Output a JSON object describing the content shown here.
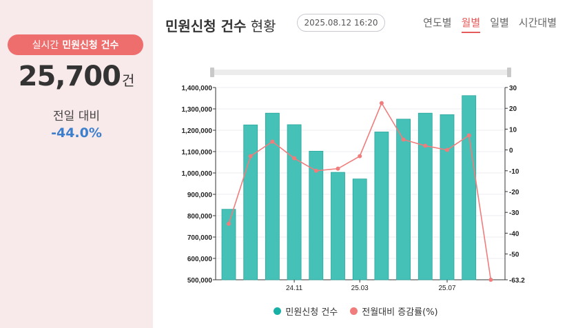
{
  "sidebar": {
    "realtime_prefix": "실시간",
    "realtime_bold": "민원신청 건수",
    "count": "25,700",
    "count_unit": "건",
    "compare_label": "전일 대비",
    "compare_value": "-44.0%"
  },
  "header": {
    "title_bold": "민원신청 건수",
    "title_rest": "현황",
    "datetime": "2025.08.12 16:20"
  },
  "tabs": [
    {
      "label": "연도별",
      "active": false
    },
    {
      "label": "월별",
      "active": true
    },
    {
      "label": "일별",
      "active": false
    },
    {
      "label": "시간대별",
      "active": false
    }
  ],
  "colors": {
    "bar": "#45c1b7",
    "line": "#f07c7c",
    "accent": "#ee6e6e",
    "compare": "#3d7fcc"
  },
  "chart_data": {
    "type": "bar",
    "categories": [
      "",
      "",
      "",
      "24.11",
      "",
      "",
      "25.03",
      "",
      "",
      "",
      "25.07",
      ""
    ],
    "series": [
      {
        "name": "민원신청 건수",
        "type": "bar",
        "axis": "left",
        "color": "#45c1b7",
        "values": [
          830000,
          1225000,
          1280000,
          1226000,
          1102000,
          1003000,
          972000,
          1192000,
          1252000,
          1280000,
          1273000,
          1362000,
          null
        ]
      },
      {
        "name": "전월대비 증감률(%)",
        "type": "line",
        "axis": "right",
        "color": "#f07c7c",
        "values": [
          -35.5,
          -3,
          4,
          -4,
          -10,
          -9,
          -3,
          22.5,
          5,
          2,
          0,
          7,
          -63.2
        ]
      }
    ],
    "y_left": {
      "min": 500000,
      "max": 1400000,
      "ticks": [
        "500,000",
        "600,000",
        "700,000",
        "800,000",
        "900,000",
        "1,000,000",
        "1,100,000",
        "1,200,000",
        "1,300,000",
        "1,400,000"
      ]
    },
    "y_right": {
      "ticks": [
        "30",
        "20",
        "10",
        "0",
        "-10",
        "-20",
        "-30",
        "-40",
        "-50",
        "-63.2"
      ]
    },
    "x_ticks": [
      "24.11",
      "25.03",
      "25.07"
    ],
    "legend_position": "bottom-center",
    "grid": true
  }
}
